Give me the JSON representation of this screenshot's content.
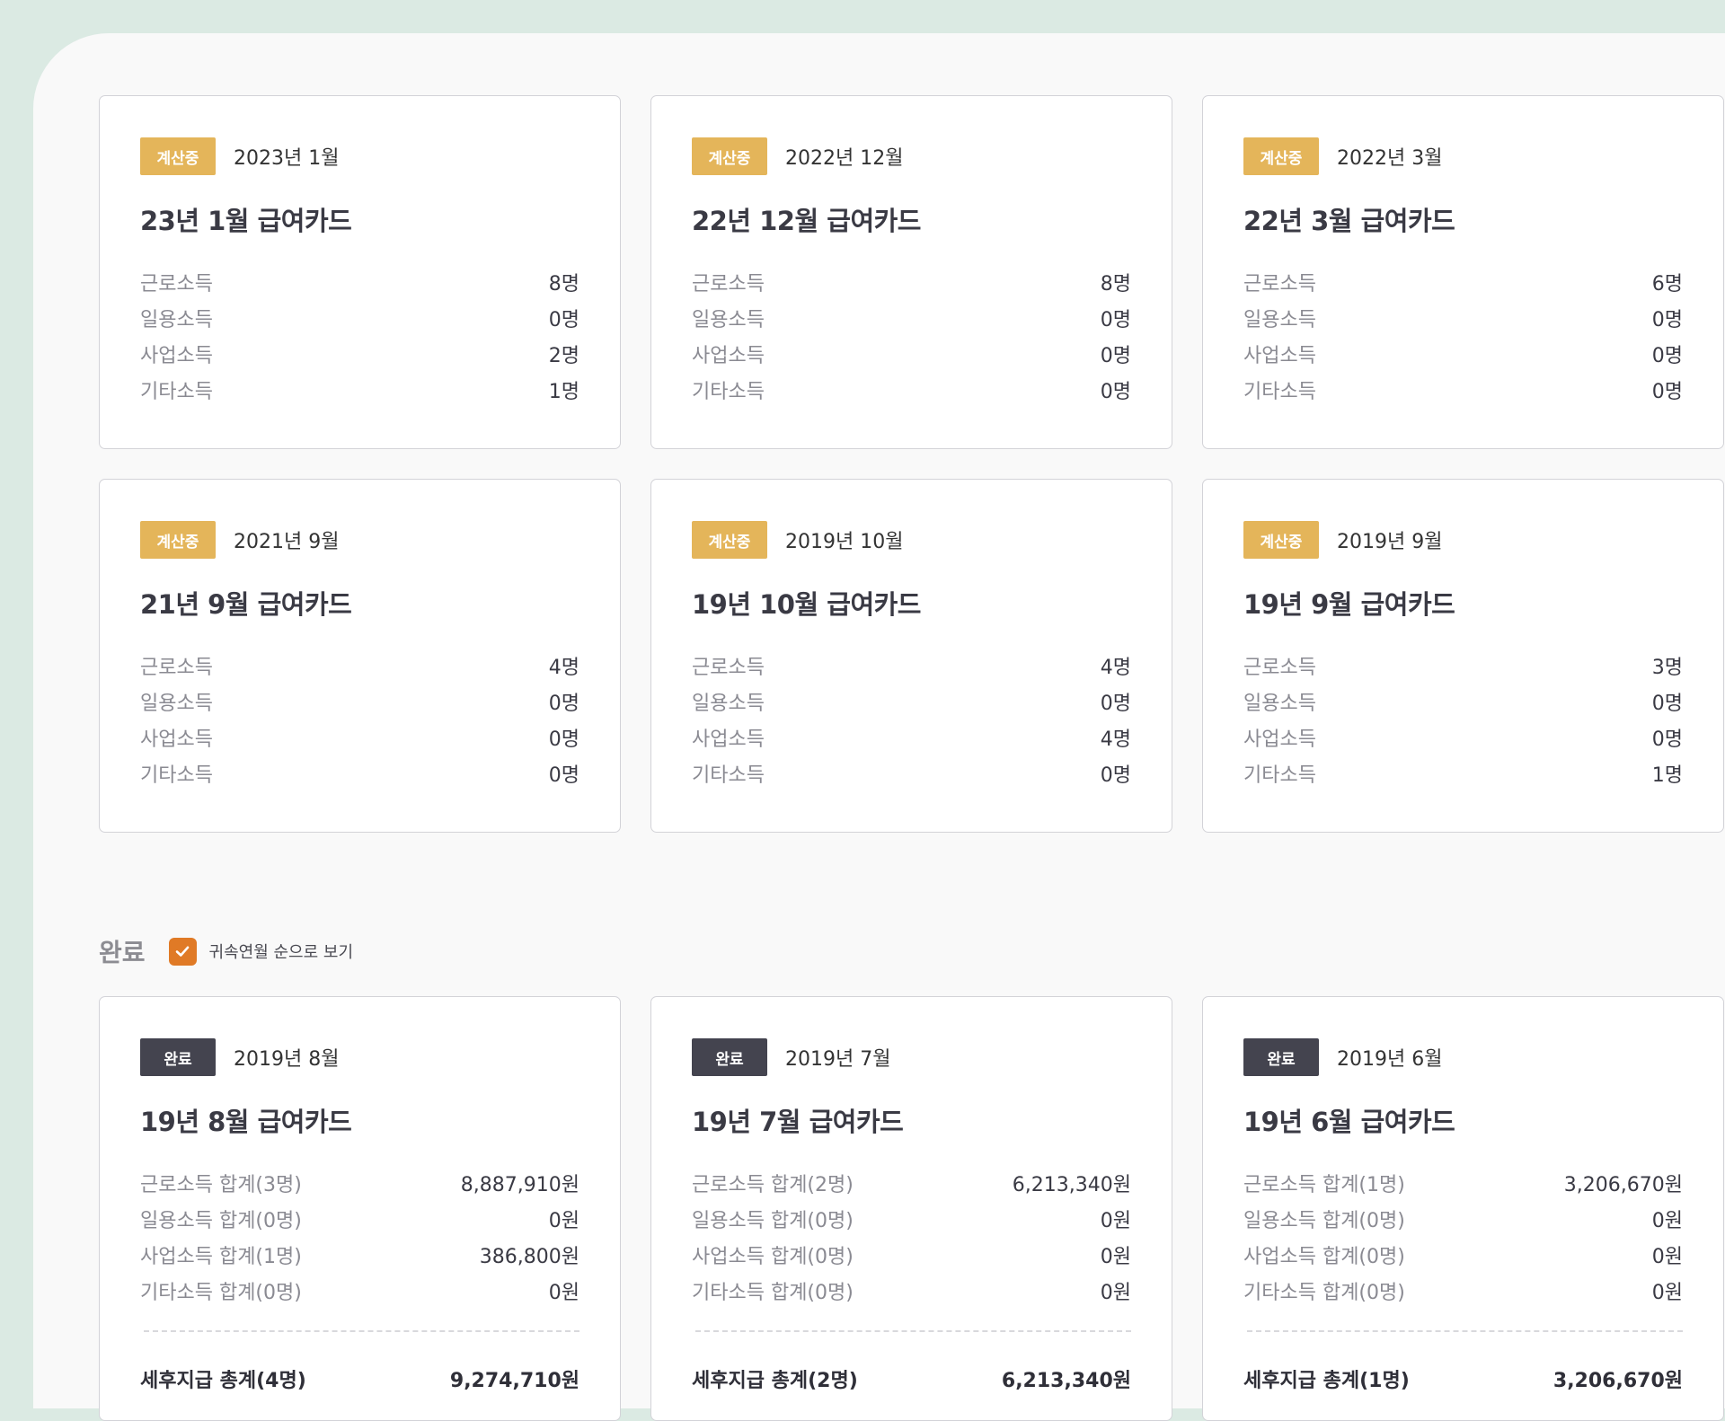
{
  "pending": {
    "cards": [
      {
        "badge": "계산중",
        "period": "2023년 1월",
        "title": "23년 1월 급여카드",
        "rows": [
          {
            "label": "근로소득",
            "value": "8명"
          },
          {
            "label": "일용소득",
            "value": "0명"
          },
          {
            "label": "사업소득",
            "value": "2명"
          },
          {
            "label": "기타소득",
            "value": "1명"
          }
        ]
      },
      {
        "badge": "계산중",
        "period": "2022년 12월",
        "title": "22년 12월 급여카드",
        "rows": [
          {
            "label": "근로소득",
            "value": "8명"
          },
          {
            "label": "일용소득",
            "value": "0명"
          },
          {
            "label": "사업소득",
            "value": "0명"
          },
          {
            "label": "기타소득",
            "value": "0명"
          }
        ]
      },
      {
        "badge": "계산중",
        "period": "2022년 3월",
        "title": "22년 3월 급여카드",
        "rows": [
          {
            "label": "근로소득",
            "value": "6명"
          },
          {
            "label": "일용소득",
            "value": "0명"
          },
          {
            "label": "사업소득",
            "value": "0명"
          },
          {
            "label": "기타소득",
            "value": "0명"
          }
        ]
      },
      {
        "badge": "계산중",
        "period": "2021년 9월",
        "title": "21년 9월 급여카드",
        "rows": [
          {
            "label": "근로소득",
            "value": "4명"
          },
          {
            "label": "일용소득",
            "value": "0명"
          },
          {
            "label": "사업소득",
            "value": "0명"
          },
          {
            "label": "기타소득",
            "value": "0명"
          }
        ]
      },
      {
        "badge": "계산중",
        "period": "2019년 10월",
        "title": "19년 10월 급여카드",
        "rows": [
          {
            "label": "근로소득",
            "value": "4명"
          },
          {
            "label": "일용소득",
            "value": "0명"
          },
          {
            "label": "사업소득",
            "value": "4명"
          },
          {
            "label": "기타소득",
            "value": "0명"
          }
        ]
      },
      {
        "badge": "계산중",
        "period": "2019년 9월",
        "title": "19년 9월 급여카드",
        "rows": [
          {
            "label": "근로소득",
            "value": "3명"
          },
          {
            "label": "일용소득",
            "value": "0명"
          },
          {
            "label": "사업소득",
            "value": "0명"
          },
          {
            "label": "기타소득",
            "value": "1명"
          }
        ]
      }
    ]
  },
  "completed": {
    "section_title": "완료",
    "sort_checked": true,
    "sort_label": "귀속연월 순으로 보기",
    "cards": [
      {
        "badge": "완료",
        "period": "2019년 8월",
        "title": "19년 8월 급여카드",
        "rows": [
          {
            "label": "근로소득 합계(3명)",
            "value": "8,887,910원"
          },
          {
            "label": "일용소득 합계(0명)",
            "value": "0원"
          },
          {
            "label": "사업소득 합계(1명)",
            "value": "386,800원"
          },
          {
            "label": "기타소득 합계(0명)",
            "value": "0원"
          }
        ],
        "total_label": "세후지급 총계(4명)",
        "total_value": "9,274,710원"
      },
      {
        "badge": "완료",
        "period": "2019년 7월",
        "title": "19년 7월 급여카드",
        "rows": [
          {
            "label": "근로소득 합계(2명)",
            "value": "6,213,340원"
          },
          {
            "label": "일용소득 합계(0명)",
            "value": "0원"
          },
          {
            "label": "사업소득 합계(0명)",
            "value": "0원"
          },
          {
            "label": "기타소득 합계(0명)",
            "value": "0원"
          }
        ],
        "total_label": "세후지급 총계(2명)",
        "total_value": "6,213,340원"
      },
      {
        "badge": "완료",
        "period": "2019년 6월",
        "title": "19년 6월 급여카드",
        "rows": [
          {
            "label": "근로소득 합계(1명)",
            "value": "3,206,670원"
          },
          {
            "label": "일용소득 합계(0명)",
            "value": "0원"
          },
          {
            "label": "사업소득 합계(0명)",
            "value": "0원"
          },
          {
            "label": "기타소득 합계(0명)",
            "value": "0원"
          }
        ],
        "total_label": "세후지급 총계(1명)",
        "total_value": "3,206,670원"
      }
    ]
  },
  "colors": {
    "calc_badge": "#e4b55a",
    "done_badge": "#44444f",
    "checkbox": "#e07a26",
    "frame": "#dbeae3"
  }
}
